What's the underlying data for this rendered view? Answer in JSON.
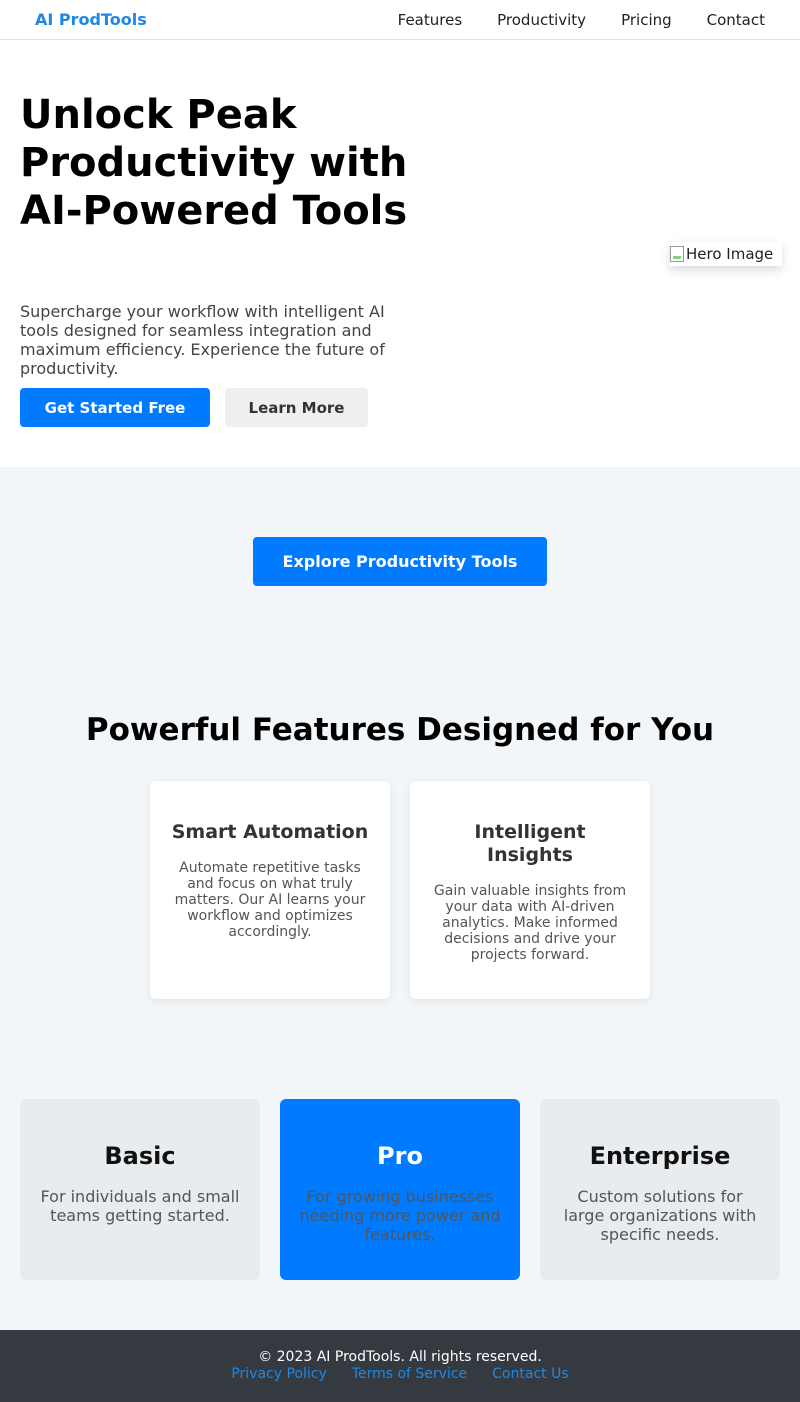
{
  "nav": {
    "brand": "AI ProdTools",
    "links": [
      "Features",
      "Productivity",
      "Pricing",
      "Contact"
    ]
  },
  "hero": {
    "title": "Unlock Peak Productivity with AI-Powered Tools",
    "description": "Supercharge your workflow with intelligent AI tools designed for seamless integration and maximum efficiency. Experience the future of productivity.",
    "primary_button": "Get Started Free",
    "secondary_button": "Learn More",
    "image_alt": "Hero Image",
    "image_icon": "broken-image-icon"
  },
  "cta": {
    "explore_button": "Explore Productivity Tools"
  },
  "features": {
    "title": "Powerful Features Designed for You",
    "cards": [
      {
        "title": "Smart Automation",
        "text": "Automate repetitive tasks and focus on what truly matters. Our AI learns your workflow and optimizes accordingly."
      },
      {
        "title": "Intelligent Insights",
        "text": "Gain valuable insights from your data with AI-driven analytics. Make informed decisions and drive your projects forward."
      }
    ]
  },
  "plans": [
    {
      "name": "Basic",
      "text": "For individuals and small teams getting started."
    },
    {
      "name": "Pro",
      "text": "For growing businesses needing more power and features."
    },
    {
      "name": "Enterprise",
      "text": "Custom solutions for large organizations with specific needs."
    }
  ],
  "footer": {
    "copyright": "© 2023 AI ProdTools. All rights reserved.",
    "links": [
      "Privacy Policy",
      "Terms of Service",
      "Contact Us"
    ]
  },
  "colors": {
    "primary": "#007bff",
    "brand": "#1e88e5",
    "footer_bg": "#343a40",
    "page_bg": "#f3f6f9"
  }
}
